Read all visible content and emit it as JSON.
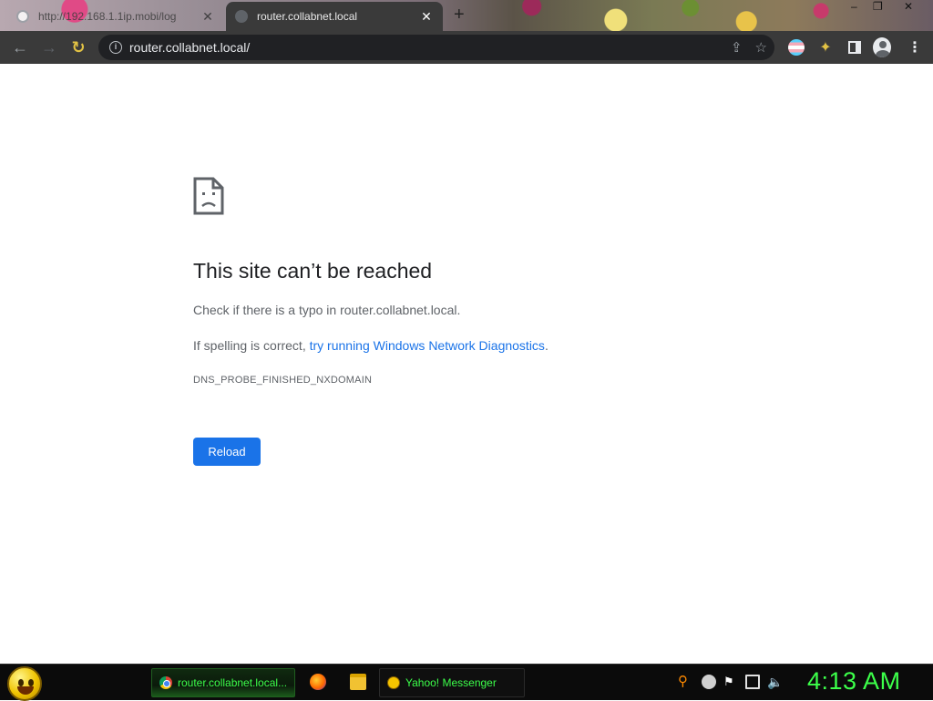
{
  "browser": {
    "tabs": [
      {
        "title": "http://192.168.1.1ip.mobi/log",
        "active": false
      },
      {
        "title": "router.collabnet.local",
        "active": true
      }
    ],
    "new_tab_label": "+",
    "window_controls": {
      "minimize": "–",
      "restore": "❐",
      "close": "✕"
    },
    "url": "router.collabnet.local/",
    "icons": {
      "back": "←",
      "forward": "→",
      "reload": "↻",
      "info": "i",
      "share": "⇪",
      "bookmark": "☆",
      "extensions": "✦",
      "menu": "⋮"
    }
  },
  "error_page": {
    "title": "This site can’t be reached",
    "typo_message": "Check if there is a typo in router.collabnet.local.",
    "spelling_prefix": "If spelling is correct, ",
    "diagnostics_link": "try running Windows Network Diagnostics",
    "spelling_suffix": ".",
    "error_code": "DNS_PROBE_FINISHED_NXDOMAIN",
    "reload_button": "Reload"
  },
  "taskbar": {
    "tasks": [
      {
        "label": "router.collabnet.local...",
        "icon": "chrome-icon"
      },
      {
        "label": "Yahoo! Messenger",
        "icon": "yahoo-messenger-icon"
      }
    ],
    "clock": "4:13 AM",
    "tray_icons": {
      "search": "⚲",
      "flag": "⚑",
      "volume": "🔈"
    }
  },
  "colors": {
    "link": "#1a73e8",
    "button": "#1a73e8",
    "toolbar": "#3a3a3a",
    "clock": "#3cff4a"
  }
}
